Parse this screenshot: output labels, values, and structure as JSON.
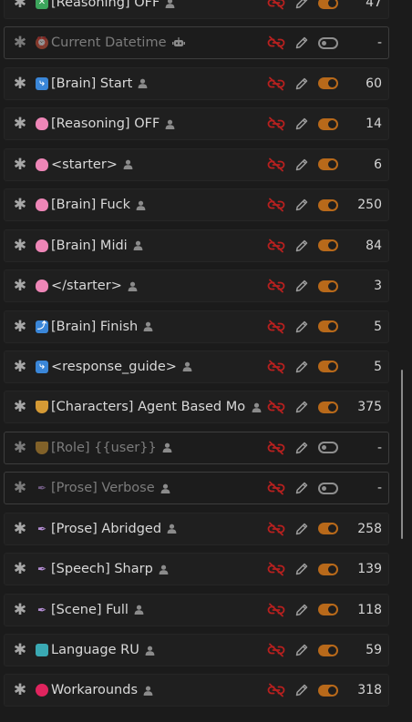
{
  "prompts": [
    {
      "icon": "cross-mark-icon",
      "glyph": "✕",
      "emoji_class": "cross",
      "name": "[Reasoning] OFF",
      "role": "user",
      "enabled": true,
      "tokens": "47"
    },
    {
      "icon": "alarm-clock-icon",
      "glyph": "⏰",
      "emoji_class": "clock",
      "name": "Current Datetime",
      "role": "assistant",
      "enabled": false,
      "tokens": "-"
    },
    {
      "icon": "right-arrow-curving-icon",
      "glyph": "⤷",
      "emoji_class": "arrow-right",
      "name": "[Brain] Start",
      "role": "user",
      "enabled": true,
      "tokens": "60"
    },
    {
      "icon": "brain-icon",
      "glyph": "",
      "emoji_class": "brain",
      "name": "[Reasoning] OFF",
      "role": "user",
      "enabled": true,
      "tokens": "14"
    },
    {
      "icon": "brain-icon",
      "glyph": "",
      "emoji_class": "brain",
      "name": "<starter>",
      "role": "user",
      "enabled": true,
      "tokens": "6"
    },
    {
      "icon": "brain-icon",
      "glyph": "",
      "emoji_class": "brain",
      "name": "[Brain] Fuck",
      "role": "user",
      "enabled": true,
      "tokens": "250"
    },
    {
      "icon": "brain-icon",
      "glyph": "",
      "emoji_class": "brain",
      "name": "[Brain] Midi",
      "role": "user",
      "enabled": true,
      "tokens": "84"
    },
    {
      "icon": "brain-icon",
      "glyph": "",
      "emoji_class": "brain",
      "name": "</starter>",
      "role": "user",
      "enabled": true,
      "tokens": "3"
    },
    {
      "icon": "up-arrow-curving-icon",
      "glyph": "⤴",
      "emoji_class": "arrow-up",
      "name": "[Brain] Finish",
      "role": "user",
      "enabled": true,
      "tokens": "5"
    },
    {
      "icon": "right-arrow-curving-icon",
      "glyph": "⤷",
      "emoji_class": "arrow-right",
      "name": "<response_guide>",
      "role": "user",
      "enabled": true,
      "tokens": "5"
    },
    {
      "icon": "theater-masks-icon",
      "glyph": "",
      "emoji_class": "masks",
      "name": "[Characters] Agent Based Model",
      "role": "user",
      "enabled": true,
      "tokens": "375"
    },
    {
      "icon": "theater-masks-icon",
      "glyph": "",
      "emoji_class": "masks",
      "name": "[Role] {{user}}",
      "role": "user",
      "enabled": false,
      "tokens": "-"
    },
    {
      "icon": "fountain-pen-icon",
      "glyph": "✒",
      "emoji_class": "pen",
      "name": "[Prose] Verbose",
      "role": "user",
      "enabled": false,
      "tokens": "-"
    },
    {
      "icon": "fountain-pen-icon",
      "glyph": "✒",
      "emoji_class": "pen",
      "name": "[Prose] Abridged",
      "role": "user",
      "enabled": true,
      "tokens": "258"
    },
    {
      "icon": "fountain-pen-icon",
      "glyph": "✒",
      "emoji_class": "pen",
      "name": "[Speech] Sharp",
      "role": "user",
      "enabled": true,
      "tokens": "139"
    },
    {
      "icon": "fountain-pen-icon",
      "glyph": "✒",
      "emoji_class": "pen",
      "name": "[Scene] Full",
      "role": "user",
      "enabled": true,
      "tokens": "118"
    },
    {
      "icon": "world-map-icon",
      "glyph": "",
      "emoji_class": "map",
      "name": "Language RU",
      "role": "user",
      "enabled": true,
      "tokens": "59"
    },
    {
      "icon": "red-circle-icon",
      "glyph": "",
      "emoji_class": "circle",
      "name": "Workarounds",
      "role": "user",
      "enabled": true,
      "tokens": "318"
    }
  ],
  "colors": {
    "toggle_on": "#b8691a",
    "unlink_red": "#c32020",
    "background": "#1b1b1b"
  }
}
